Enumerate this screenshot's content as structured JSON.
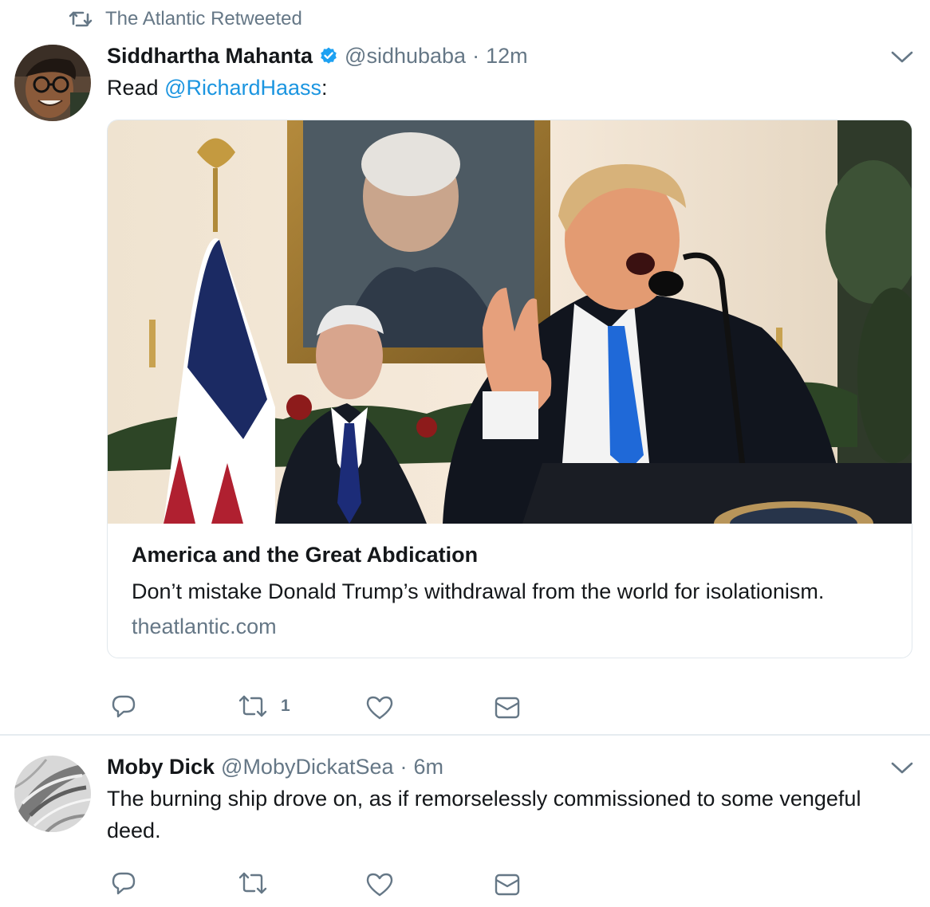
{
  "colors": {
    "accent": "#1b95e0",
    "secondary_text": "#657786",
    "primary_text": "#14171a",
    "border": "#e1e8ed"
  },
  "tweets": [
    {
      "retweet_context": "The Atlantic Retweeted",
      "name": "Siddhartha Mahanta",
      "verified": true,
      "handle": "@sidhubaba",
      "dot": "·",
      "time": "12m",
      "text_prefix": "Read ",
      "mention": "@RichardHaass",
      "text_suffix": ":",
      "card": {
        "title": "America and the Great Abdication",
        "description": "Don’t mistake Donald Trump’s withdrawal from the world for isolationism.",
        "domain": "theatlantic.com"
      },
      "actions": [
        {
          "icon": "reply-icon",
          "count": ""
        },
        {
          "icon": "retweet-icon",
          "count": "1"
        },
        {
          "icon": "like-icon",
          "count": ""
        },
        {
          "icon": "message-icon",
          "count": ""
        }
      ]
    },
    {
      "name": "Moby Dick",
      "verified": false,
      "handle": "@MobyDickatSea",
      "dot": "·",
      "time": "6m",
      "text": "The burning ship drove on, as if remorselessly commissioned to some vengeful deed.",
      "actions": [
        {
          "icon": "reply-icon",
          "count": ""
        },
        {
          "icon": "retweet-icon",
          "count": ""
        },
        {
          "icon": "like-icon",
          "count": ""
        },
        {
          "icon": "message-icon",
          "count": ""
        }
      ]
    }
  ]
}
